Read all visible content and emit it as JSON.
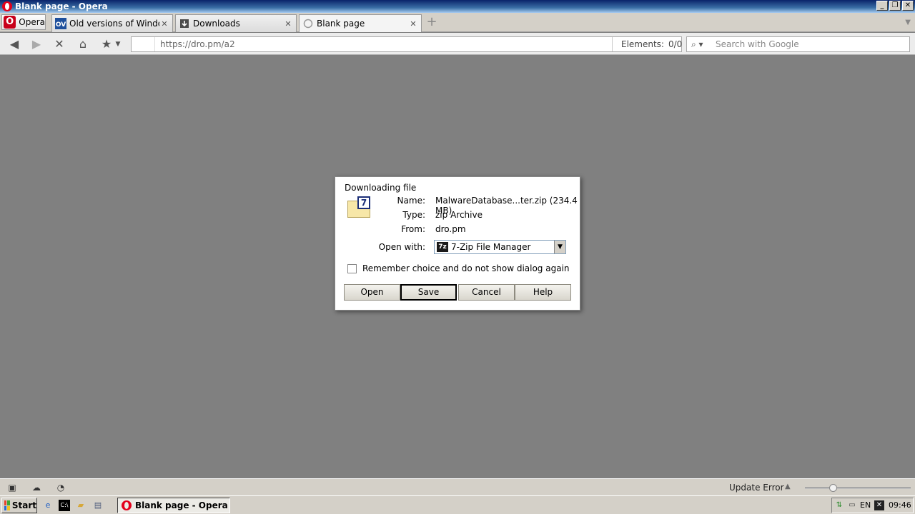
{
  "window": {
    "title": "Blank page - Opera",
    "buttons": [
      "_",
      "❐",
      "✕"
    ]
  },
  "tabbar": {
    "menu_label": "Opera",
    "tabs": [
      {
        "label": "Old versions of Windows, ...",
        "close": "✕"
      },
      {
        "label": "Downloads",
        "close": "✕"
      },
      {
        "label": "Blank page",
        "close": "✕"
      }
    ],
    "new_tab": "+"
  },
  "navbar": {
    "url": "https://dro.pm/a2",
    "elements_label": "Elements:",
    "elements_value": "0/0",
    "search_placeholder": "Search with Google"
  },
  "dialog": {
    "title": "Downloading file",
    "name_label": "Name:",
    "name_value": "MalwareDatabase...ter.zip (234.4 MB)",
    "type_label": "Type:",
    "type_value": "zip Archive",
    "from_label": "From:",
    "from_value": "dro.pm",
    "openwith_label": "Open with:",
    "openwith_value": "7-Zip File Manager",
    "openwith_icon_text": "7z",
    "remember_label": "Remember choice and do not show dialog again",
    "remember_checked": false,
    "buttons": {
      "open": "Open",
      "save": "Save",
      "cancel": "Cancel",
      "help": "Help"
    }
  },
  "statusbar": {
    "update_text": "Update Error",
    "zoom_level": 0.27
  },
  "taskbar": {
    "start_label": "Start",
    "active_task": "Blank page - Opera",
    "language": "EN",
    "clock": "09:46"
  },
  "colors": {
    "content_bg": "#808080",
    "titlebar": "#0a246a",
    "opera_red": "#e3001b"
  }
}
